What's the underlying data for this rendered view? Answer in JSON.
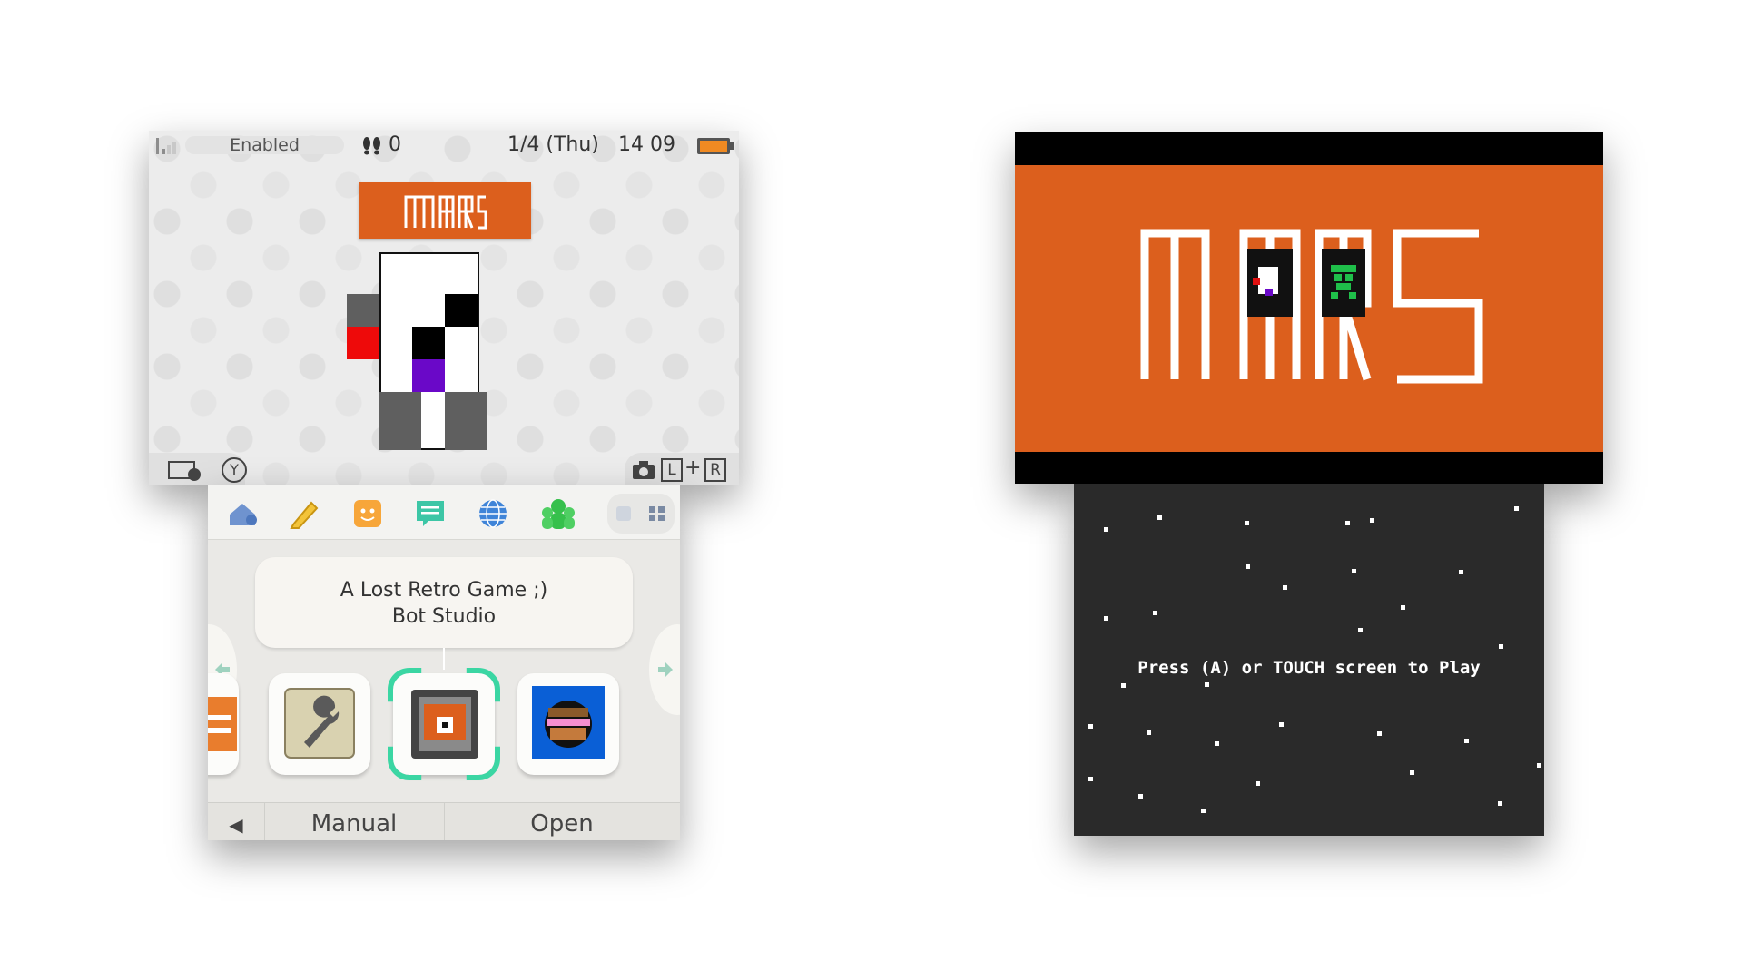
{
  "status_bar": {
    "wifi_label": "Enabled",
    "steps_count": "0",
    "date": "1/4 (Thu)",
    "time": "14 09"
  },
  "top_screen": {
    "banner_logo_text": "MARS",
    "bottom_left_hint": "Y",
    "bottom_right_hint_l": "L",
    "bottom_right_hint_plus": "+",
    "bottom_right_hint_r": "R"
  },
  "info_box": {
    "line1": "A Lost Retro Game ;)",
    "line2": "Bot Studio"
  },
  "menu_tabs": [
    "settings-home-icon",
    "pencil-icon",
    "smiley-icon",
    "chat-icon",
    "globe-icon",
    "friends-icon",
    "grid-icon"
  ],
  "bottom_bar": {
    "back_glyph": "◀",
    "manual_label": "Manual",
    "open_label": "Open"
  },
  "game_screen": {
    "title_text": "MARS",
    "prompt": "Press (A) or TOUCH screen to Play"
  },
  "colors": {
    "accent_orange": "#dc5f1d",
    "game_bg": "#2a2a2a",
    "selection_green": "#3bd6a3"
  }
}
